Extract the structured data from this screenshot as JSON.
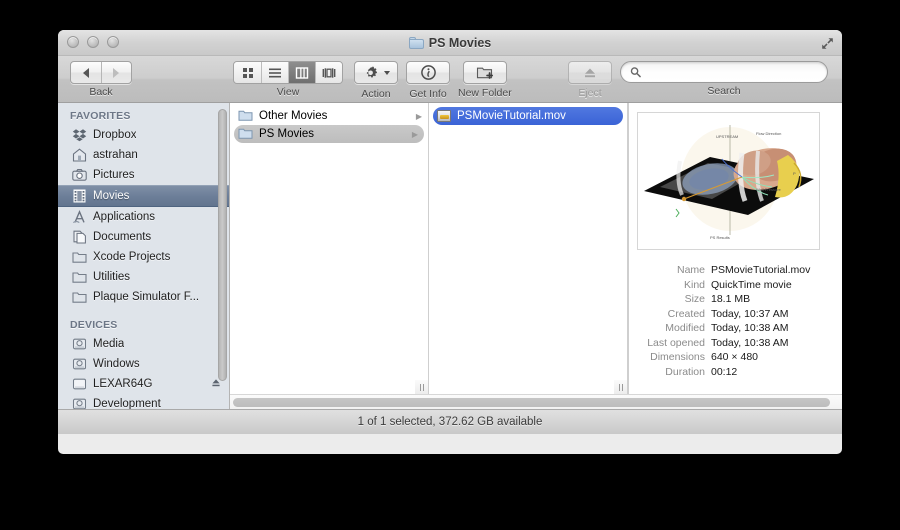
{
  "window": {
    "title": "PS Movies",
    "title_icon": "folder-icon",
    "traffic_lights": [
      "close-button",
      "minimize-button",
      "zoom-button"
    ],
    "fullscreen_icon": "fullscreen-arrows-icon"
  },
  "toolbar": {
    "nav": {
      "label": "Back",
      "back_icon": "triangle-left-icon",
      "forward_icon": "triangle-right-icon"
    },
    "view": {
      "label": "View",
      "modes": [
        {
          "name": "icon-view",
          "icon": "grid-icon",
          "active": false
        },
        {
          "name": "list-view",
          "icon": "lines-icon",
          "active": false
        },
        {
          "name": "column-view",
          "icon": "columns-icon",
          "active": true
        },
        {
          "name": "coverflow-view",
          "icon": "coverflow-icon",
          "active": false
        }
      ]
    },
    "action": {
      "label": "Action",
      "icon": "gear-icon"
    },
    "get_info": {
      "label": "Get Info",
      "icon": "info-circle-icon"
    },
    "new_folder": {
      "label": "New Folder",
      "icon": "new-folder-icon"
    },
    "eject": {
      "label": "Eject",
      "icon": "eject-icon",
      "disabled": true
    },
    "search": {
      "label": "Search",
      "placeholder": "",
      "value": "",
      "icon": "search-icon"
    }
  },
  "sidebar": {
    "sections": [
      {
        "heading": "FAVORITES",
        "items": [
          {
            "label": "Dropbox",
            "icon": "dropbox-icon",
            "selected": false
          },
          {
            "label": "astrahan",
            "icon": "home-icon",
            "selected": false
          },
          {
            "label": "Pictures",
            "icon": "camera-icon",
            "selected": false
          },
          {
            "label": "Movies",
            "icon": "film-icon",
            "selected": true
          },
          {
            "label": "Applications",
            "icon": "app-a-icon",
            "selected": false
          },
          {
            "label": "Documents",
            "icon": "documents-icon",
            "selected": false
          },
          {
            "label": "Xcode Projects",
            "icon": "folder-icon",
            "selected": false
          },
          {
            "label": "Utilities",
            "icon": "folder-icon",
            "selected": false
          },
          {
            "label": "Plaque Simulator F...",
            "icon": "folder-icon",
            "selected": false
          }
        ]
      },
      {
        "heading": "DEVICES",
        "items": [
          {
            "label": "Media",
            "icon": "hard-disk-icon",
            "selected": false,
            "eject": false
          },
          {
            "label": "Windows",
            "icon": "hard-disk-icon",
            "selected": false,
            "eject": false
          },
          {
            "label": "LEXAR64G",
            "icon": "removable-disk-icon",
            "selected": false,
            "eject": true
          },
          {
            "label": "Development",
            "icon": "hard-disk-icon",
            "selected": false,
            "eject": false
          }
        ]
      }
    ]
  },
  "columns": [
    {
      "name": "column-folders",
      "rows": [
        {
          "label": "Other Movies",
          "icon": "folder-icon",
          "disclosure": true,
          "selection": "none"
        },
        {
          "label": "PS Movies",
          "icon": "folder-icon",
          "disclosure": true,
          "selection": "gray"
        }
      ]
    },
    {
      "name": "column-files",
      "rows": [
        {
          "label": "PSMovieTutorial.mov",
          "icon": "quicktime-movie-icon",
          "disclosure": false,
          "selection": "blue"
        }
      ]
    }
  ],
  "preview": {
    "thumbnail_alt": "3D scientific visualization preview",
    "metadata": [
      {
        "key": "Name",
        "value": "PSMovieTutorial.mov"
      },
      {
        "key": "Kind",
        "value": "QuickTime movie"
      },
      {
        "key": "Size",
        "value": "18.1 MB"
      },
      {
        "key": "Created",
        "value": "Today, 10:37 AM"
      },
      {
        "key": "Modified",
        "value": "Today, 10:38 AM"
      },
      {
        "key": "Last opened",
        "value": "Today, 10:38 AM"
      },
      {
        "key": "Dimensions",
        "value": "640 × 480"
      },
      {
        "key": "Duration",
        "value": "00:12"
      }
    ]
  },
  "status_bar": {
    "text": "1 of 1 selected, 372.62 GB available"
  },
  "colors": {
    "selection_blue": "#3a63d6",
    "sidebar_selection": "#6d7f99",
    "sidebar_bg": "#dfe4ea",
    "toolbar_bg": "#c5c5c5"
  }
}
